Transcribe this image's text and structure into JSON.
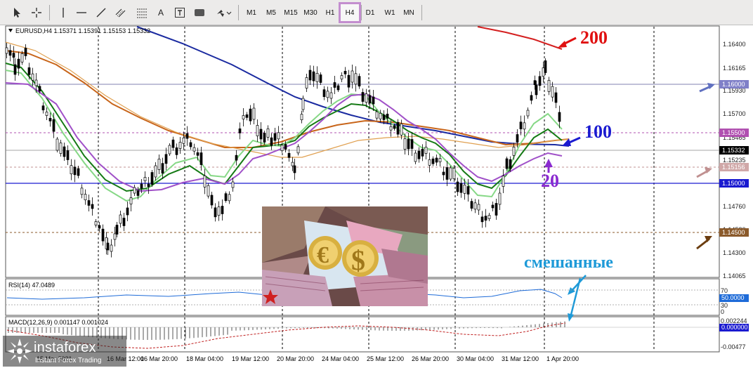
{
  "toolbar": {
    "tools": [
      "cursor-icon",
      "crosshair-icon",
      "vertical-line-icon",
      "horizontal-line-icon",
      "trendline-icon",
      "channel-icon",
      "fibonacci-icon",
      "text-icon",
      "text-label-icon",
      "rectangle-icon",
      "arrows-icon"
    ],
    "timeframes": [
      {
        "label": "M1",
        "active": false
      },
      {
        "label": "M5",
        "active": false
      },
      {
        "label": "M15",
        "active": false
      },
      {
        "label": "M30",
        "active": false
      },
      {
        "label": "H1",
        "active": false
      },
      {
        "label": "H4",
        "active": true
      },
      {
        "label": "D1",
        "active": false
      },
      {
        "label": "W1",
        "active": false
      },
      {
        "label": "MN",
        "active": false
      }
    ]
  },
  "chart": {
    "symbol_info": "EURUSD,H4  1.15371 1.15391 1.15153 1.15332",
    "price_labels": [
      "1.16400",
      "1.16165",
      "1.15930",
      "1.15700",
      "1.15465",
      "1.15235",
      "1.14760",
      "1.14530",
      "1.14300",
      "1.14065"
    ],
    "highlighted_labels": {
      "level_16000": "1.16000",
      "level_15500": "1.15500",
      "current": "1.15332",
      "level_15156": "1.15156",
      "level_15000": "1.15000",
      "level_14500": "1.14500"
    },
    "time_labels": [
      "15 Mar 2021",
      "16 Mar 12:00",
      "16 Mar 20:00",
      "18 Mar 04:00",
      "19 Mar 12:00",
      "20 Mar 20:00",
      "24 Mar 04:00",
      "25 Mar 12:00",
      "26 Mar 20:00",
      "30 Mar 04:00",
      "31 Mar 12:00",
      "1 Apr 20:00"
    ],
    "colors": {
      "ma200": "#d42020",
      "ma100": "#1a2aa0",
      "ma_orange": "#c8651a",
      "ma_tan": "#e0a050",
      "ma_green": "#157a15",
      "ma_lightgreen": "#86d886",
      "ma20_purple": "#a050c8",
      "candle": "#000000",
      "level_blue": "#1a1ad0",
      "level_purple": "#b050b0"
    }
  },
  "annotations": {
    "ma200_label": "200",
    "ma100_label": "100",
    "ma20_label": "20",
    "mixed_label": "смешанные"
  },
  "rsi": {
    "title": "RSI(14) 47.0489",
    "scale": [
      "70",
      "50.0000",
      "30",
      "0"
    ]
  },
  "macd": {
    "title": "MACD(12,26,9) 0.001147 0.001024",
    "scale": [
      "0.002244",
      "0.000000",
      "-0.00477"
    ]
  },
  "logo": {
    "name": "instaforex",
    "tagline": "Instant Forex Trading"
  }
}
